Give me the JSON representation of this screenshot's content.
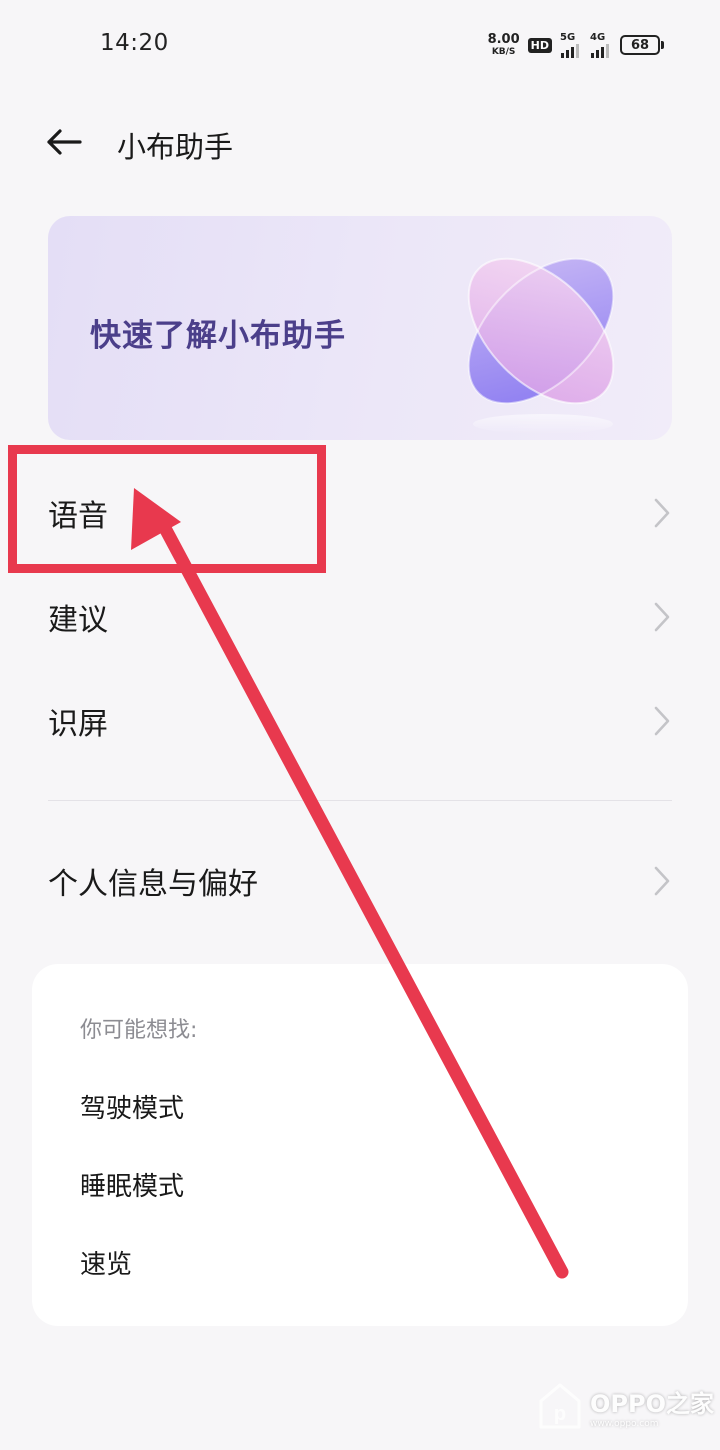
{
  "status_bar": {
    "time": "14:20",
    "net_speed_value": "8.00",
    "net_speed_unit": "KB/S",
    "hd_badge": "HD",
    "sim1_type": "5G",
    "sim2_type": "4G",
    "battery": "68"
  },
  "header": {
    "title": "小布助手",
    "back_icon": "back-arrow-icon"
  },
  "banner": {
    "text": "快速了解小布助手",
    "colors": {
      "text": "#4b3f8a",
      "bg_start": "#e4def6",
      "bg_end": "#f1ecf9"
    }
  },
  "menu": {
    "items": [
      {
        "label": "语音",
        "icon": "chevron-right-icon"
      },
      {
        "label": "建议",
        "icon": "chevron-right-icon"
      },
      {
        "label": "识屏",
        "icon": "chevron-right-icon"
      },
      {
        "label": "个人信息与偏好",
        "icon": "chevron-right-icon"
      }
    ]
  },
  "suggestions": {
    "heading": "你可能想找:",
    "items": [
      "驾驶模式",
      "睡眠模式",
      "速览"
    ]
  },
  "annotation": {
    "color": "#e8394e",
    "highlighted_item": "语音"
  },
  "watermark": {
    "text": "OPPO之家",
    "sub": "www.oppo.com"
  }
}
